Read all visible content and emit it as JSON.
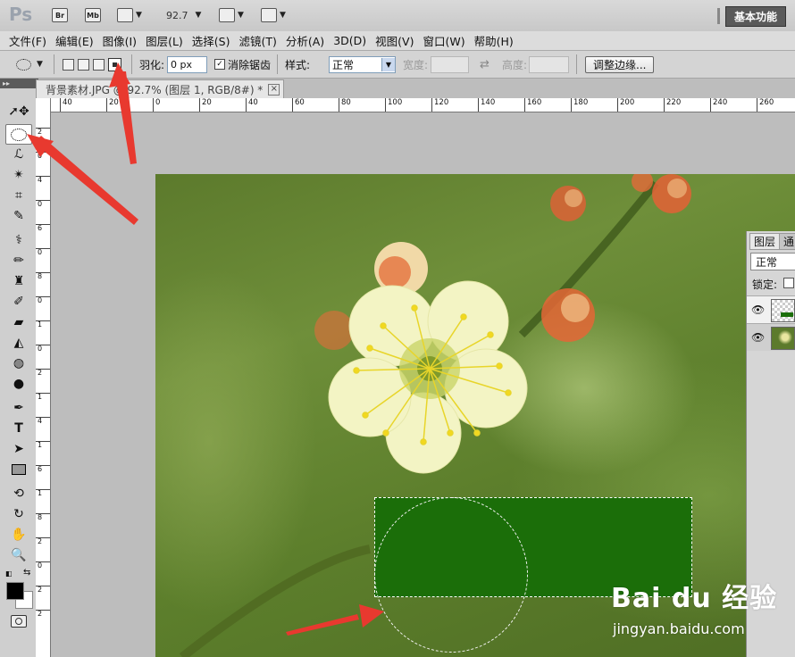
{
  "appbar": {
    "logo": "Ps",
    "bridge": "Br",
    "minibridge": "Mb",
    "zoom": "92.7",
    "workspace": "基本功能"
  },
  "menu": [
    "文件(F)",
    "编辑(E)",
    "图像(I)",
    "图层(L)",
    "选择(S)",
    "滤镜(T)",
    "分析(A)",
    "3D(D)",
    "视图(V)",
    "窗口(W)",
    "帮助(H)"
  ],
  "options": {
    "feather_label": "羽化:",
    "feather_value": "0 px",
    "antialias_label": "消除锯齿",
    "antialias_checked": true,
    "style_label": "样式:",
    "style_value": "正常",
    "width_label": "宽度:",
    "height_label": "高度:",
    "refine_button": "调整边缘..."
  },
  "document": {
    "tab_title": "背景素材.JPG @ 92.7% (图层 1, RGB/8#) *",
    "close": "×"
  },
  "ruler": {
    "h_labels": [
      "40",
      "20",
      "0",
      "20",
      "40",
      "60",
      "80",
      "100",
      "120",
      "140",
      "160",
      "180",
      "200",
      "220",
      "240",
      "260"
    ],
    "v_labels": [
      "2",
      "0",
      "4",
      "0",
      "6",
      "0",
      "8",
      "0",
      "1",
      "0",
      "2",
      "1",
      "4",
      "1",
      "6",
      "1",
      "8",
      "2",
      "0",
      "2",
      "2"
    ]
  },
  "layers_panel": {
    "tab_layers": "图层",
    "tab_channels": "通",
    "blend_mode": "正常",
    "lock_label": "锁定:"
  },
  "watermark": {
    "logo": "Bai du 经验",
    "url": "jingyan.baidu.com"
  },
  "icons": [
    "ellipse-marquee-icon",
    "move-icon",
    "lasso-icon",
    "magic-wand-icon",
    "crop-icon",
    "eyedropper-icon",
    "healing-icon",
    "brush-icon",
    "stamp-icon",
    "history-brush-icon",
    "eraser-icon",
    "bucket-icon",
    "dodge-icon",
    "pen-icon",
    "type-icon",
    "path-select-icon",
    "rectangle-icon",
    "3d-rotate-icon",
    "hand-icon",
    "zoom-icon"
  ],
  "colors": {
    "fill": "#1b6e09",
    "foreground": "#000000",
    "background": "#ffffff",
    "annotation_arrow": "#e8392f"
  }
}
